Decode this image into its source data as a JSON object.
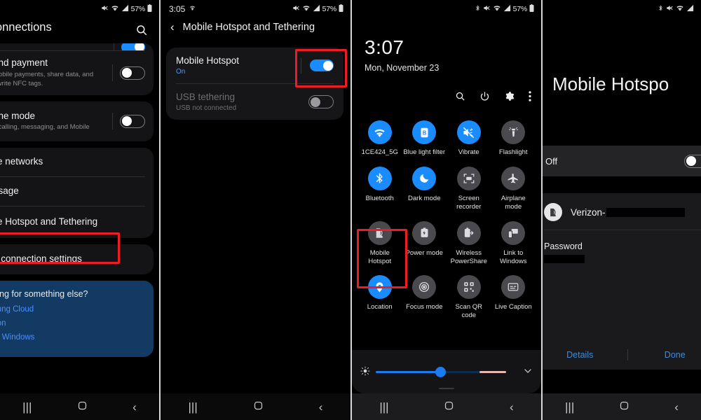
{
  "panel1": {
    "status": {
      "icons": [
        "mute-icon",
        "wifi-icon",
        "signal-icon"
      ],
      "battery": "57%"
    },
    "title": "Connections",
    "search_icon": "search-icon",
    "items": [
      {
        "title": "and payment",
        "sub": "mobile payments, share data, and\nr write NFC tags.",
        "toggle": "off"
      },
      {
        "title": "ane mode",
        "sub": "ff calling, messaging, and Mobile",
        "toggle": "off"
      },
      {
        "title": "ile networks",
        "sub": "",
        "toggle": null
      },
      {
        "title": "usage",
        "sub": "",
        "toggle": null
      },
      {
        "title": "ile Hotspot and Tethering",
        "sub": "",
        "toggle": null
      },
      {
        "title": "e connection settings",
        "sub": "",
        "toggle": null
      }
    ],
    "promo": {
      "heading": "king for something else?",
      "links": [
        "sung Cloud",
        "tion",
        "to Windows"
      ]
    },
    "highlight": "mobile-hotspot-and-tethering",
    "nav": [
      "recents-icon",
      "home-icon",
      "back-icon"
    ]
  },
  "panel2": {
    "status": {
      "time": "3:05",
      "alarm_icon": "wifi-calling-icon",
      "battery": "57%"
    },
    "back_icon": "back-arrow-icon",
    "title": "Mobile Hotspot and Tethering",
    "rows": [
      {
        "title": "Mobile Hotspot",
        "sub": "On",
        "toggle": "on",
        "enabled": true
      },
      {
        "title": "USB tethering",
        "sub": "USB not connected",
        "toggle": "off",
        "enabled": false
      }
    ],
    "highlight": "mobile-hotspot-toggle",
    "nav": [
      "recents-icon",
      "home-icon",
      "back-icon"
    ]
  },
  "panel3": {
    "status": {
      "icons": [
        "bluetooth-icon",
        "mute-icon",
        "wifi-icon",
        "signal-icon"
      ],
      "battery": "57%"
    },
    "time": "3:07",
    "date": "Mon, November 23",
    "actions": [
      "search-icon",
      "power-icon",
      "gear-icon",
      "more-icon"
    ],
    "tiles": [
      {
        "label": "1CE424_5G",
        "icon": "wifi-icon",
        "on": true
      },
      {
        "label": "Blue light filter",
        "icon": "blue-light-filter-icon",
        "on": true
      },
      {
        "label": "Vibrate",
        "icon": "vibrate-icon",
        "on": true
      },
      {
        "label": "Flashlight",
        "icon": "flashlight-icon",
        "on": false
      },
      {
        "label": "Bluetooth",
        "icon": "bluetooth-icon",
        "on": true
      },
      {
        "label": "Dark mode",
        "icon": "dark-mode-icon",
        "on": true
      },
      {
        "label": "Screen recorder",
        "icon": "screen-recorder-icon",
        "on": false
      },
      {
        "label": "Airplane mode",
        "icon": "airplane-icon",
        "on": false
      },
      {
        "label": "Mobile Hotspot",
        "icon": "mobile-hotspot-icon",
        "on": false
      },
      {
        "label": "Power mode",
        "icon": "power-mode-icon",
        "on": false
      },
      {
        "label": "Wireless PowerShare",
        "icon": "wireless-powershare-icon",
        "on": false
      },
      {
        "label": "Link to Windows",
        "icon": "link-to-windows-icon",
        "on": false
      },
      {
        "label": "Location",
        "icon": "location-icon",
        "on": true
      },
      {
        "label": "Focus mode",
        "icon": "focus-mode-icon",
        "on": false
      },
      {
        "label": "Scan QR code",
        "icon": "qr-code-icon",
        "on": false
      },
      {
        "label": "Live Caption",
        "icon": "live-caption-icon",
        "on": false
      }
    ],
    "pages": {
      "count": 2,
      "active": 0
    },
    "brightness": {
      "icon": "brightness-icon",
      "percent": 46,
      "expand_icon": "chevron-down-icon"
    },
    "highlight": "mobile-hotspot-tile",
    "nav": [
      "recents-icon",
      "home-icon",
      "back-icon"
    ]
  },
  "panel4": {
    "status": {
      "icons": [
        "bluetooth-icon",
        "mute-icon",
        "wifi-icon",
        "signal-icon"
      ]
    },
    "title": "Mobile Hotspo",
    "state_label": "Off",
    "state_toggle": "off",
    "network": {
      "icon": "mobile-hotspot-icon",
      "ssid": "Verizon-",
      "ssid_redacted": true
    },
    "password_label": "Password",
    "password_redacted": true,
    "buttons": {
      "details": "Details",
      "done": "Done"
    },
    "nav": [
      "recents-icon",
      "home-icon",
      "back-icon"
    ]
  },
  "colors": {
    "accent": "#1a8cff",
    "link": "#4c8dff",
    "highlight": "#ee1c24",
    "promo_bg": "#123a63"
  }
}
